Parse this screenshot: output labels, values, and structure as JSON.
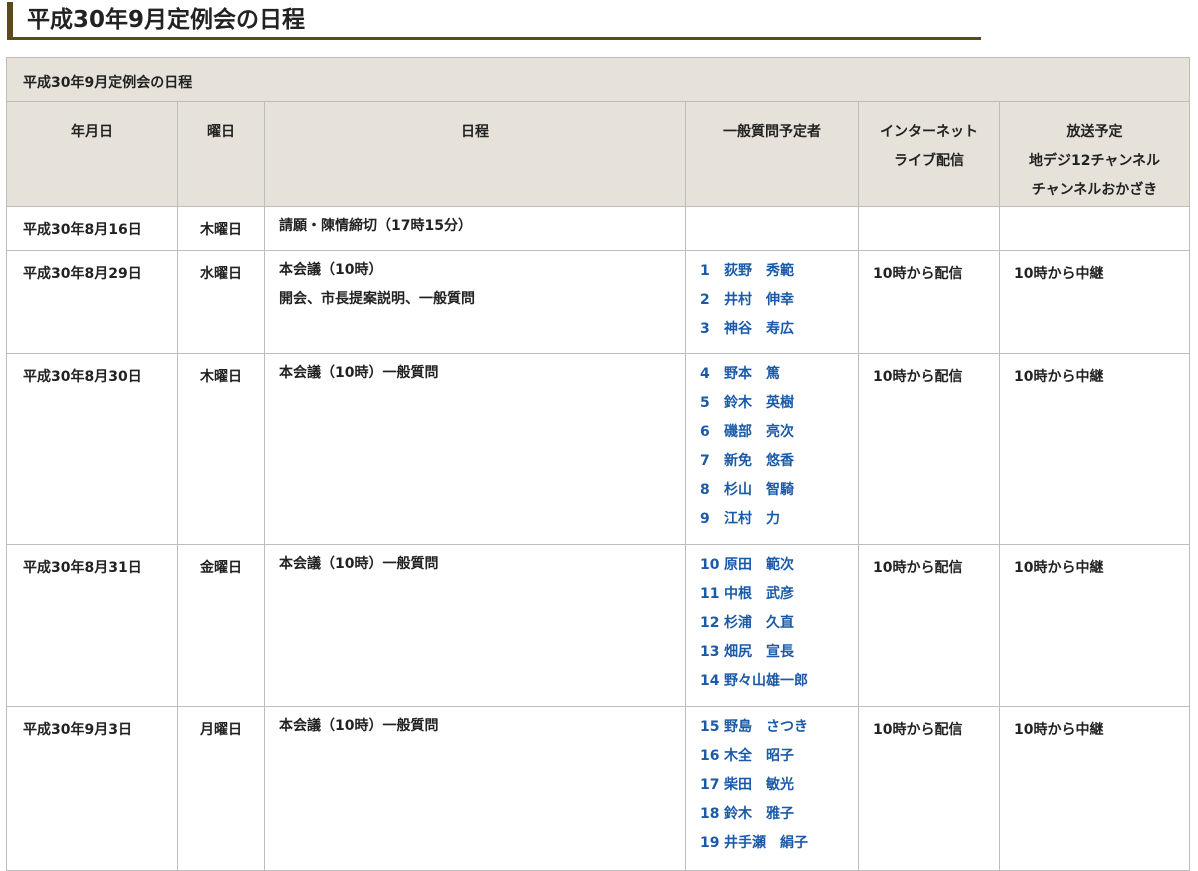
{
  "page": {
    "heading": "平成30年9月定例会の日程"
  },
  "table": {
    "caption": "平成30年9月定例会の日程",
    "headers": {
      "date": "年月日",
      "day": "曜日",
      "schedule": "日程",
      "speakers": "一般質問予定者",
      "net_line1": "インターネット",
      "net_line2": "ライブ配信",
      "tv_line1": "放送予定",
      "tv_line2": "地デジ12チャンネル",
      "tv_line3": "チャンネルおかざき"
    },
    "rows": [
      {
        "date": "平成30年8月16日",
        "day": "木曜日",
        "schedule": [
          "請願・陳情締切（17時15分）"
        ],
        "speakers": [],
        "net": "",
        "tv": ""
      },
      {
        "date": "平成30年8月29日",
        "day": "水曜日",
        "schedule": [
          "本会議（10時）",
          "開会、市長提案説明、一般質問"
        ],
        "speakers": [
          {
            "num": "1",
            "name": "荻野　秀範"
          },
          {
            "num": "2",
            "name": "井村　伸幸"
          },
          {
            "num": "3",
            "name": "神谷　寿広"
          }
        ],
        "net": "10時から配信",
        "tv": "10時から中継"
      },
      {
        "date": "平成30年8月30日",
        "day": "木曜日",
        "schedule": [
          "本会議（10時）一般質問"
        ],
        "speakers": [
          {
            "num": "4",
            "name": "野本　篤"
          },
          {
            "num": "5",
            "name": "鈴木　英樹"
          },
          {
            "num": "6",
            "name": "磯部　亮次"
          },
          {
            "num": "7",
            "name": "新免　悠香"
          },
          {
            "num": "8",
            "name": "杉山　智騎"
          },
          {
            "num": "9",
            "name": "江村　力"
          }
        ],
        "net": "10時から配信",
        "tv": "10時から中継"
      },
      {
        "date": "平成30年8月31日",
        "day": "金曜日",
        "schedule": [
          "本会議（10時）一般質問"
        ],
        "speakers": [
          {
            "num": "10",
            "name": "原田　範次"
          },
          {
            "num": "11",
            "name": "中根　武彦"
          },
          {
            "num": "12",
            "name": "杉浦　久直"
          },
          {
            "num": "13",
            "name": "畑尻　宣長"
          },
          {
            "num": "14",
            "name": "野々山雄一郎"
          }
        ],
        "net": "10時から配信",
        "tv": "10時から中継"
      },
      {
        "date": "平成30年9月3日",
        "day": "月曜日",
        "schedule": [
          "本会議（10時）一般質問"
        ],
        "speakers": [
          {
            "num": "15",
            "name": "野島　さつき"
          },
          {
            "num": "16",
            "name": "木全　昭子"
          },
          {
            "num": "17",
            "name": "柴田　敏光"
          },
          {
            "num": "18",
            "name": "鈴木　雅子"
          },
          {
            "num": "19",
            "name": "井手瀬　絹子"
          }
        ],
        "net": "10時から配信",
        "tv": "10時から中継"
      }
    ]
  },
  "colors": {
    "accent": "#5a4a1c",
    "header_bg": "#e6e2da",
    "link": "#1a5aa8",
    "border": "#bdbdbd"
  }
}
